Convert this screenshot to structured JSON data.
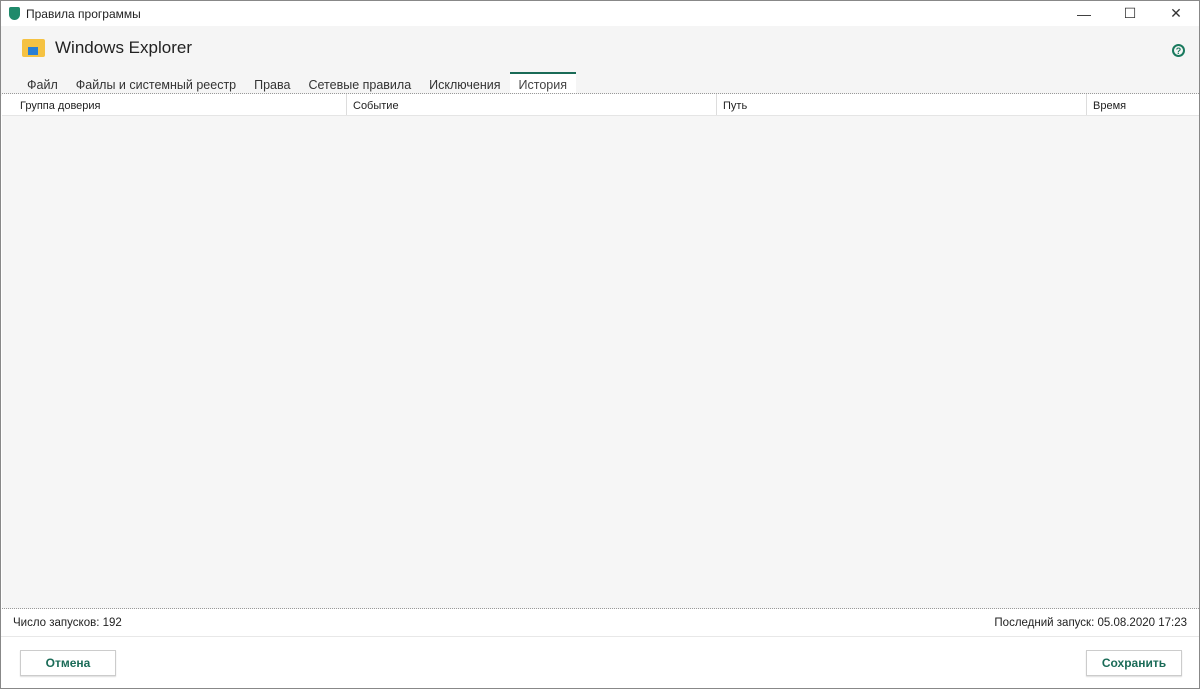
{
  "window": {
    "title": "Правила программы",
    "minimize": "—",
    "maximize": "☐",
    "close": "✕"
  },
  "header": {
    "app_title": "Windows Explorer",
    "help": "?"
  },
  "tabs": [
    {
      "label": "Файл"
    },
    {
      "label": "Файлы и системный реестр"
    },
    {
      "label": "Права"
    },
    {
      "label": "Сетевые правила"
    },
    {
      "label": "Исключения"
    },
    {
      "label": "История",
      "active": true
    }
  ],
  "table": {
    "columns": [
      "Группа доверия",
      "Событие",
      "Путь",
      "Время"
    ],
    "rows": []
  },
  "footer": {
    "launch_count": "Число запусков: 192",
    "last_launch": "Последний запуск: 05.08.2020 17:23"
  },
  "buttons": {
    "cancel": "Отмена",
    "save": "Сохранить"
  }
}
